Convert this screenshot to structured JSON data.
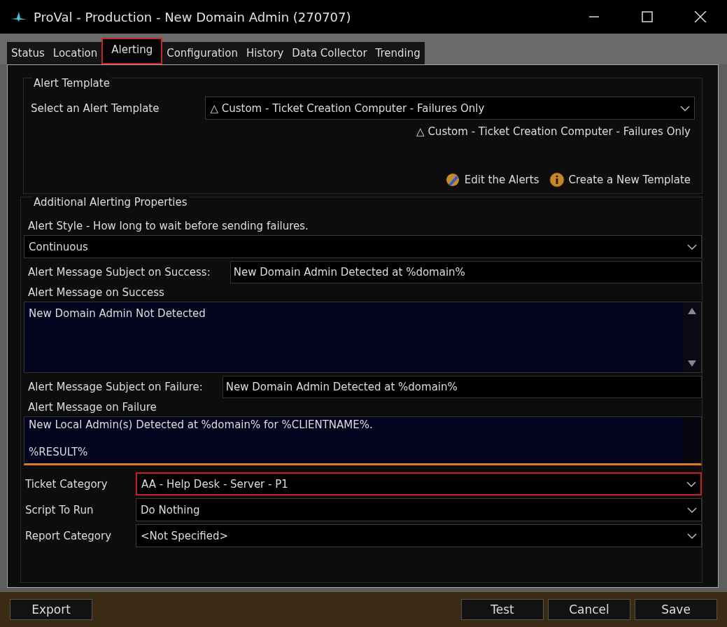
{
  "window": {
    "title": "ProVal - Production - New Domain Admin (270707)"
  },
  "tabs": [
    {
      "label": "Status",
      "selected": false,
      "highlighted": false
    },
    {
      "label": "Location",
      "selected": false,
      "highlighted": false
    },
    {
      "label": "Alerting",
      "selected": true,
      "highlighted": true
    },
    {
      "label": "Configuration",
      "selected": false,
      "highlighted": false
    },
    {
      "label": "History",
      "selected": false,
      "highlighted": false
    },
    {
      "label": "Data Collector",
      "selected": false,
      "highlighted": false
    },
    {
      "label": "Trending",
      "selected": false,
      "highlighted": false
    }
  ],
  "alert_template": {
    "heading": "Alert Template",
    "label": "Select an Alert Template",
    "value": "△ Custom - Ticket Creation Computer - Failures Only",
    "preview": "△ Custom - Ticket Creation Computer - Failures Only",
    "links": [
      {
        "kind": "edit",
        "label": "Edit the Alerts"
      },
      {
        "kind": "info",
        "label": "Create a New Template"
      }
    ]
  },
  "additional": {
    "heading": "Additional Alerting Properties",
    "style_label": "Alert Style - How long to wait before sending failures.",
    "style_value": "Continuous",
    "success_subject_label": "Alert Message Subject on Success:",
    "success_subject": "New Domain Admin Detected at %domain%",
    "success_message_label": "Alert Message on Success",
    "success_message": "New Domain Admin Not Detected",
    "failure_subject_label": "Alert Message Subject on Failure:",
    "failure_subject": "New Domain Admin Detected at %domain%",
    "failure_message_label": "Alert Message on Failure",
    "failure_message": [
      "New Local Admin(s) Detected at %domain% for %CLIENTNAME%.",
      "%RESULT%"
    ],
    "selects": [
      {
        "label": "Ticket Category",
        "value": "AA - Help Desk - Server - P1",
        "highlighted": true
      },
      {
        "label": "Script To Run",
        "value": "Do Nothing",
        "highlighted": false
      },
      {
        "label": "Report Category",
        "value": "<Not Specified>",
        "highlighted": false
      }
    ]
  },
  "buttons_left": [
    "Export"
  ],
  "buttons_right": [
    "Test",
    "Cancel",
    "Save"
  ]
}
